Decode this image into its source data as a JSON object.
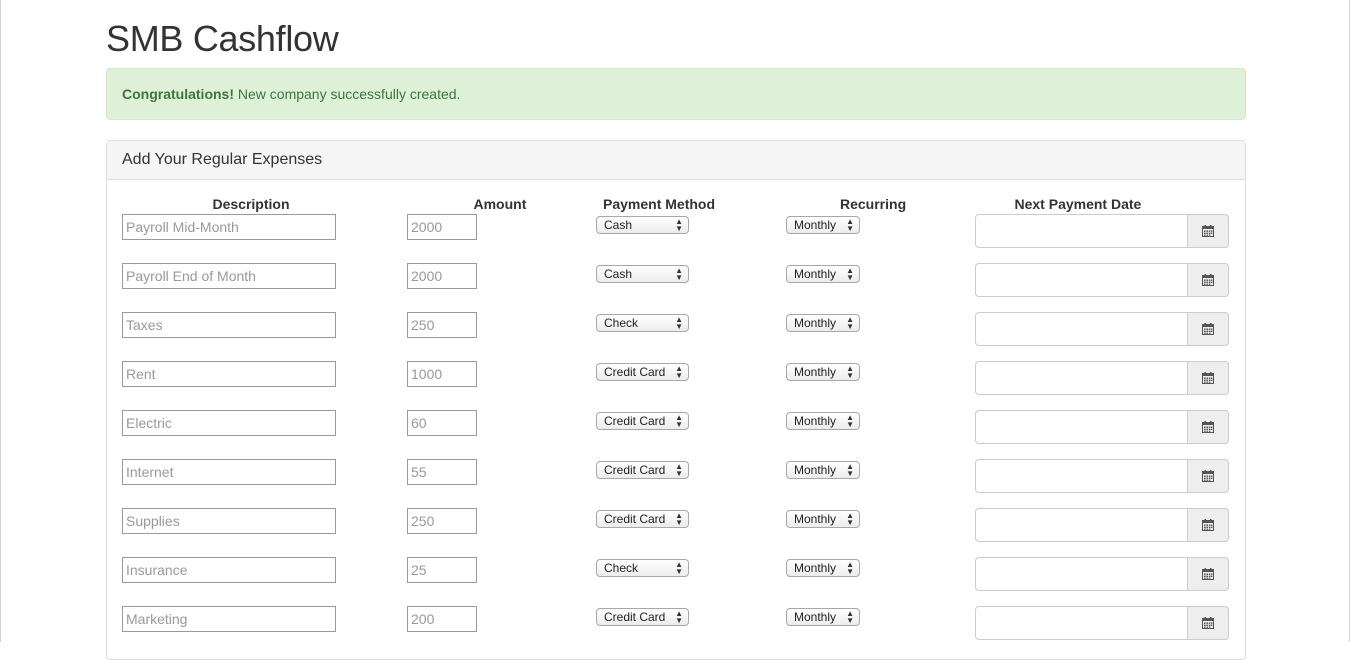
{
  "page": {
    "title": "SMB Cashflow"
  },
  "alert": {
    "strong": "Congratulations!",
    "message": " New company successfully created."
  },
  "panel": {
    "heading": "Add Your Regular Expenses",
    "columns": {
      "description": "Description",
      "amount": "Amount",
      "payment_method": "Payment Method",
      "recurring": "Recurring",
      "next_payment_date": "Next Payment Date"
    }
  },
  "expenses": [
    {
      "description": "Payroll Mid-Month",
      "amount": "2000",
      "payment_method": "Cash",
      "recurring": "Monthly",
      "next_payment_date": ""
    },
    {
      "description": "Payroll End of Month",
      "amount": "2000",
      "payment_method": "Cash",
      "recurring": "Monthly",
      "next_payment_date": ""
    },
    {
      "description": "Taxes",
      "amount": "250",
      "payment_method": "Check",
      "recurring": "Monthly",
      "next_payment_date": ""
    },
    {
      "description": "Rent",
      "amount": "1000",
      "payment_method": "Credit Card",
      "recurring": "Monthly",
      "next_payment_date": ""
    },
    {
      "description": "Electric",
      "amount": "60",
      "payment_method": "Credit Card",
      "recurring": "Monthly",
      "next_payment_date": ""
    },
    {
      "description": "Internet",
      "amount": "55",
      "payment_method": "Credit Card",
      "recurring": "Monthly",
      "next_payment_date": ""
    },
    {
      "description": "Supplies",
      "amount": "250",
      "payment_method": "Credit Card",
      "recurring": "Monthly",
      "next_payment_date": ""
    },
    {
      "description": "Insurance",
      "amount": "25",
      "payment_method": "Check",
      "recurring": "Monthly",
      "next_payment_date": ""
    },
    {
      "description": "Marketing",
      "amount": "200",
      "payment_method": "Credit Card",
      "recurring": "Monthly",
      "next_payment_date": ""
    }
  ],
  "icons": {
    "date_button": "calendar-icon"
  },
  "colors": {
    "alert_bg": "#dff0d8",
    "alert_text": "#3c763d",
    "panel_heading_bg": "#f5f5f5"
  }
}
